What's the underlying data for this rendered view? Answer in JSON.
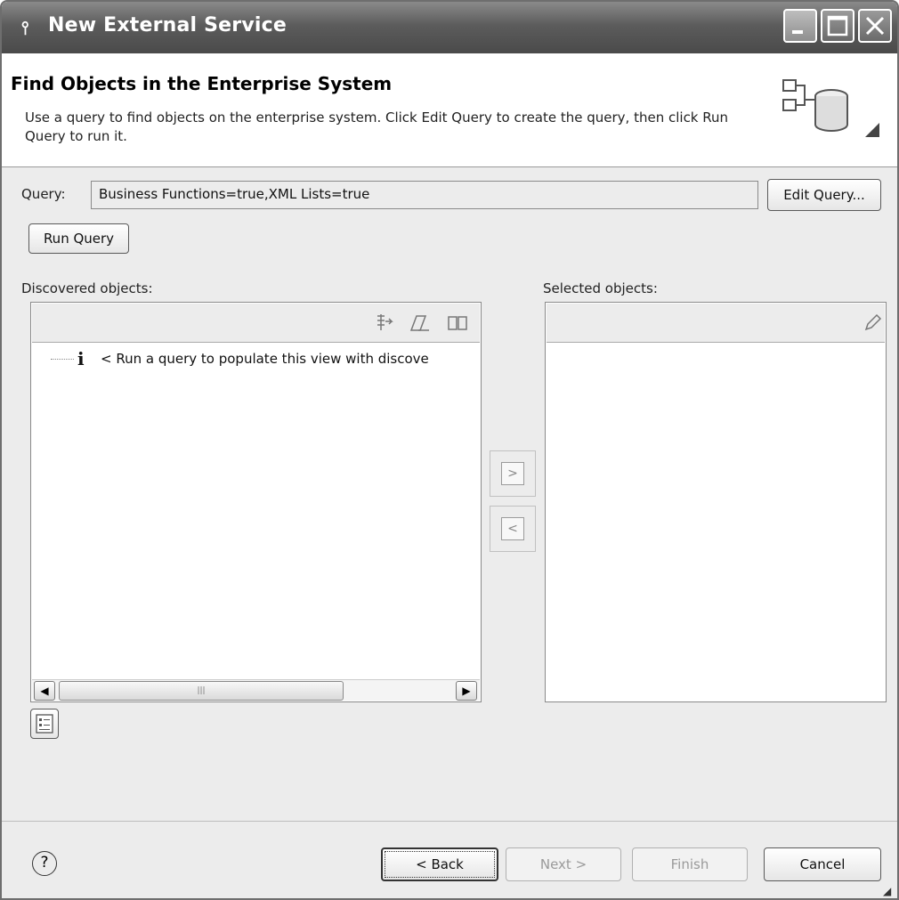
{
  "window": {
    "title": "New External Service",
    "controls": [
      "minimize",
      "maximize",
      "close"
    ]
  },
  "header": {
    "title": "Find Objects in the Enterprise System",
    "description": "Use a query to find objects on the enterprise system.  Click Edit Query to create the query, then click Run Query to run it.",
    "graphic_icon": "database-wizard-icon"
  },
  "query": {
    "label": "Query:",
    "value": "Business Functions=true,XML Lists=true",
    "edit_button": "Edit Query...",
    "run_button": "Run Query"
  },
  "discovered": {
    "label": "Discovered objects:",
    "toolbar_icons": [
      "filter-icon",
      "edit-icon",
      "properties-icon"
    ],
    "items": [
      {
        "icon": "info-icon",
        "text": "< Run a query to populate this view with discove"
      }
    ],
    "scroll_left": "scroll-left-arrow",
    "scroll_right": "scroll-right-arrow"
  },
  "movers": {
    "add": ">",
    "remove": "<"
  },
  "selected": {
    "label": "Selected objects:",
    "toolbar_icons": [
      "edit-icon"
    ],
    "items": []
  },
  "footer": {
    "help": "?",
    "back": "< Back",
    "next": "Next >",
    "finish": "Finish",
    "cancel": "Cancel"
  }
}
